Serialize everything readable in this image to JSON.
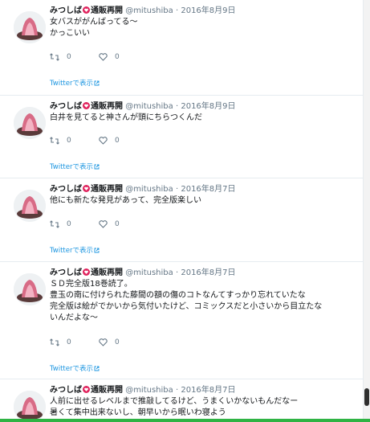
{
  "tweets": [
    {
      "name": "みつしば",
      "name_suffix": "通販再開",
      "handle": "@mitushiba",
      "separator": "·",
      "date": "2016年8月9日",
      "text": "女バスががんばってる〜\nかっこいい",
      "retweets": "0",
      "likes": "0",
      "permalink": "Twitterで表示"
    },
    {
      "name": "みつしば",
      "name_suffix": "通販再開",
      "handle": "@mitushiba",
      "separator": "·",
      "date": "2016年8月9日",
      "text": "白井を見てると神さんが頭にちらつくんだ",
      "retweets": "0",
      "likes": "0",
      "permalink": "Twitterで表示"
    },
    {
      "name": "みつしば",
      "name_suffix": "通販再開",
      "handle": "@mitushiba",
      "separator": "·",
      "date": "2016年8月7日",
      "text": "他にも新たな発見があって、完全版楽しい",
      "retweets": "0",
      "likes": "0",
      "permalink": "Twitterで表示"
    },
    {
      "name": "みつしば",
      "name_suffix": "通販再開",
      "handle": "@mitushiba",
      "separator": "·",
      "date": "2016年8月7日",
      "text": "ＳＤ完全版18巻読了。\n豊玉の南に付けられた藤間の額の傷のコトなんてすっかり忘れていたな\n完全版は絵がでかいから気付いたけど、コミックスだと小さいから目立たな\nいんだよな〜",
      "retweets": "0",
      "likes": "0",
      "permalink": "Twitterで表示"
    },
    {
      "name": "みつしば",
      "name_suffix": "通販再開",
      "handle": "@mitushiba",
      "separator": "·",
      "date": "2016年8月7日",
      "text": "人前に出せるレベルまで推敲してるけど、うまくいかないもんだなー\n暑くて集中出来ないし、朝早いから眠いわ寝よう",
      "retweets": "",
      "likes": "",
      "permalink": ""
    }
  ],
  "colors": {
    "link": "#1b95e0",
    "muted": "#657786",
    "heart_badge": "#e0245e",
    "divider": "#e6ecf0",
    "bottom_bar": "#2fb344"
  }
}
